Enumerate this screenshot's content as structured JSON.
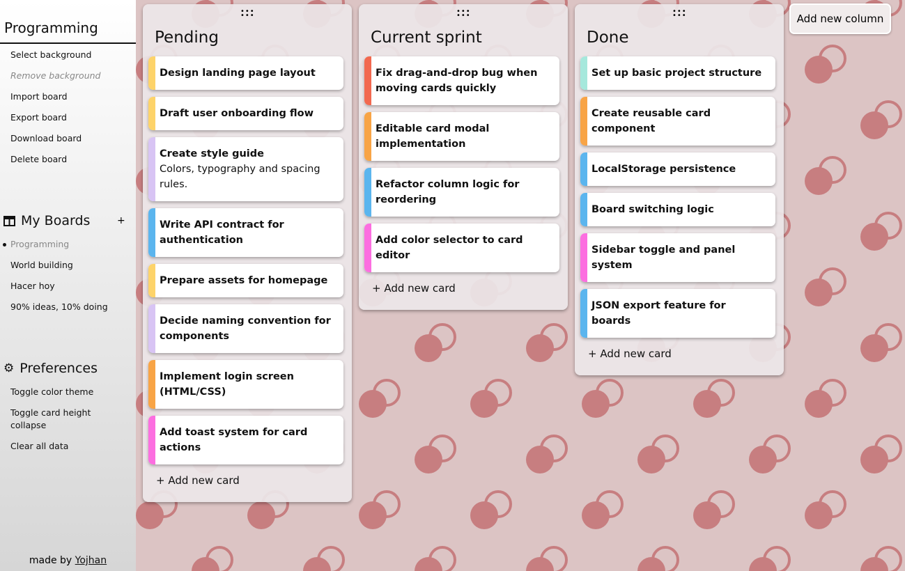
{
  "colors": {
    "yellow": "#fdd36a",
    "purple": "#d8c4f4",
    "blue": "#5bb5ee",
    "orange": "#f8a446",
    "pink": "#fc6ee0",
    "red": "#f2684f",
    "teal": "#a6e8dc",
    "pattern": "#c77e80",
    "background": "#dcc4c4"
  },
  "sidebar": {
    "board_title": "Programming",
    "board_menu": [
      "Select background",
      "Remove background",
      "Import board",
      "Export board",
      "Download board",
      "Delete board"
    ],
    "my_boards_title": "My Boards",
    "add_board": "+",
    "boards": [
      "Programming",
      "World building",
      "Hacer hoy",
      "90% ideas, 10% doing"
    ],
    "preferences_title": "Preferences",
    "preferences": [
      "Toggle color theme",
      "Toggle card height collapse",
      "Clear all data"
    ],
    "footer_prefix": "made by",
    "footer_link": "Yojhan"
  },
  "add_column": "Add new column",
  "add_card": "+ Add new card",
  "handle": "⠿",
  "columns": [
    {
      "title": "Pending",
      "cards": [
        {
          "title": "Design landing page layout",
          "color": "yellow"
        },
        {
          "title": "Draft user onboarding flow",
          "color": "yellow"
        },
        {
          "title": "Create style guide",
          "desc": "Colors, typography and spacing rules.",
          "color": "purple"
        },
        {
          "title": "Write API contract for authentication",
          "color": "blue"
        },
        {
          "title": "Prepare assets for homepage",
          "color": "yellow"
        },
        {
          "title": "Decide naming convention for components",
          "color": "purple"
        },
        {
          "title": "Implement login screen (HTML/CSS)",
          "color": "orange"
        },
        {
          "title": "Add toast system for card actions",
          "color": "pink"
        }
      ]
    },
    {
      "title": "Current sprint",
      "cards": [
        {
          "title": "Fix drag-and-drop bug when moving cards quickly",
          "color": "red"
        },
        {
          "title": "Editable card modal implementation",
          "color": "orange"
        },
        {
          "title": "Refactor column logic for reordering",
          "color": "blue"
        },
        {
          "title": "Add color selector to card editor",
          "color": "pink"
        }
      ]
    },
    {
      "title": "Done",
      "cards": [
        {
          "title": "Set up basic project structure",
          "color": "teal"
        },
        {
          "title": "Create reusable card component",
          "color": "orange"
        },
        {
          "title": "LocalStorage persistence",
          "color": "blue"
        },
        {
          "title": "Board switching logic",
          "color": "blue"
        },
        {
          "title": "Sidebar toggle and panel system",
          "color": "pink"
        },
        {
          "title": "JSON export feature for boards",
          "color": "blue"
        }
      ]
    }
  ]
}
